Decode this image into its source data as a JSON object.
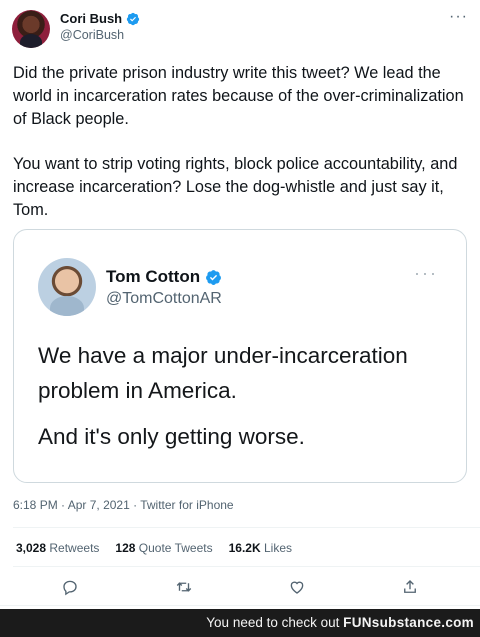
{
  "author": {
    "name": "Cori Bush",
    "handle": "@CoriBush"
  },
  "tweet": {
    "paragraph1": "Did the private prison industry write this tweet? We lead the world in incarceration rates because of the over-criminalization of Black people.",
    "paragraph2": "You want to strip voting rights, block police accountability, and increase incarceration? Lose the dog-whistle and just say it, Tom."
  },
  "quoted": {
    "name": "Tom Cotton",
    "handle": "@TomCottonAR",
    "line1": "We have a major under-incarceration problem in America.",
    "line2": "And it's only getting worse."
  },
  "meta": {
    "time": "6:18 PM",
    "date": "Apr 7, 2021",
    "source": "Twitter for iPhone"
  },
  "stats": {
    "retweets_count": "3,028",
    "retweets_label": "Retweets",
    "quotes_count": "128",
    "quotes_label": "Quote Tweets",
    "likes_count": "16.2K",
    "likes_label": "Likes"
  },
  "footer": {
    "text": "You need to check out",
    "brand": "FUNsubstance.com"
  },
  "icons": {
    "verified": "verified-badge-icon",
    "more": "more-options-icon",
    "reply": "reply-icon",
    "retweet": "retweet-icon",
    "like": "like-icon",
    "share": "share-icon"
  },
  "colors": {
    "verified": "#1d9bf0",
    "secondary_text": "#536471",
    "border": "#cfd9de"
  }
}
